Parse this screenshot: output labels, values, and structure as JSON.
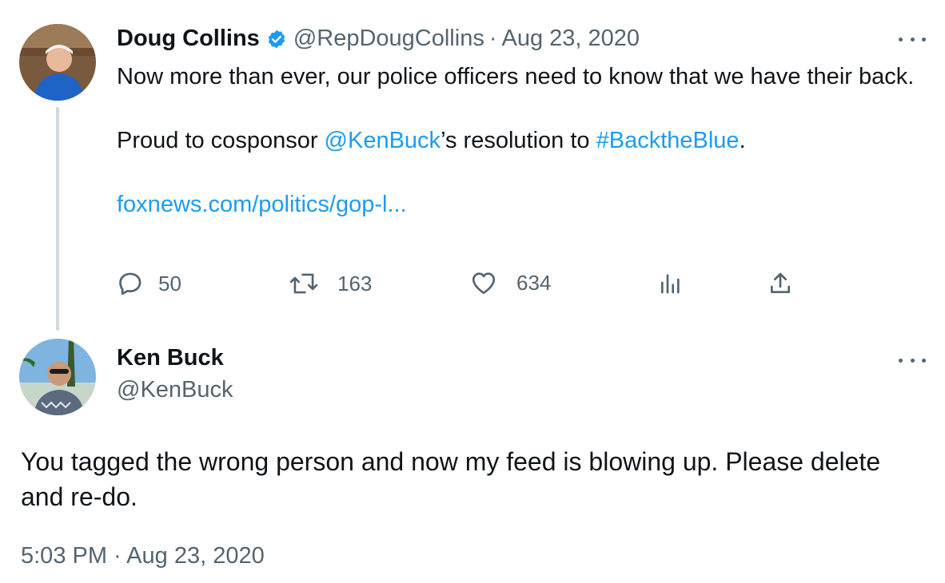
{
  "tweet1": {
    "name": "Doug Collins",
    "handle": "@RepDougCollins",
    "separator": "·",
    "date": "Aug 23, 2020",
    "line1": "Now more than ever, our police officers need to know that we have their back.",
    "line2_prefix": "Proud to cosponsor ",
    "mention": "@KenBuck",
    "line2_middle": "’s resolution to ",
    "hashtag": "#BacktheBlue",
    "line2_suffix": ".",
    "link": "foxnews.com/politics/gop-l...",
    "stats": {
      "replies": "50",
      "retweets": "163",
      "likes": "634"
    },
    "icons": [
      "verified-badge-icon",
      "more-options-icon",
      "reply-icon",
      "retweet-icon",
      "like-icon",
      "views-icon",
      "share-icon"
    ]
  },
  "tweet2": {
    "name": "Ken Buck",
    "handle": "@KenBuck",
    "text": "You tagged the wrong person and now my feed is blowing up. Please delete and re-do.",
    "timestamp": "5:03 PM · Aug 23, 2020"
  },
  "colors": {
    "link": "#1d9bf0",
    "secondary_text": "#536471",
    "primary_text": "#0f1419",
    "thread_line": "#cfd9de"
  }
}
